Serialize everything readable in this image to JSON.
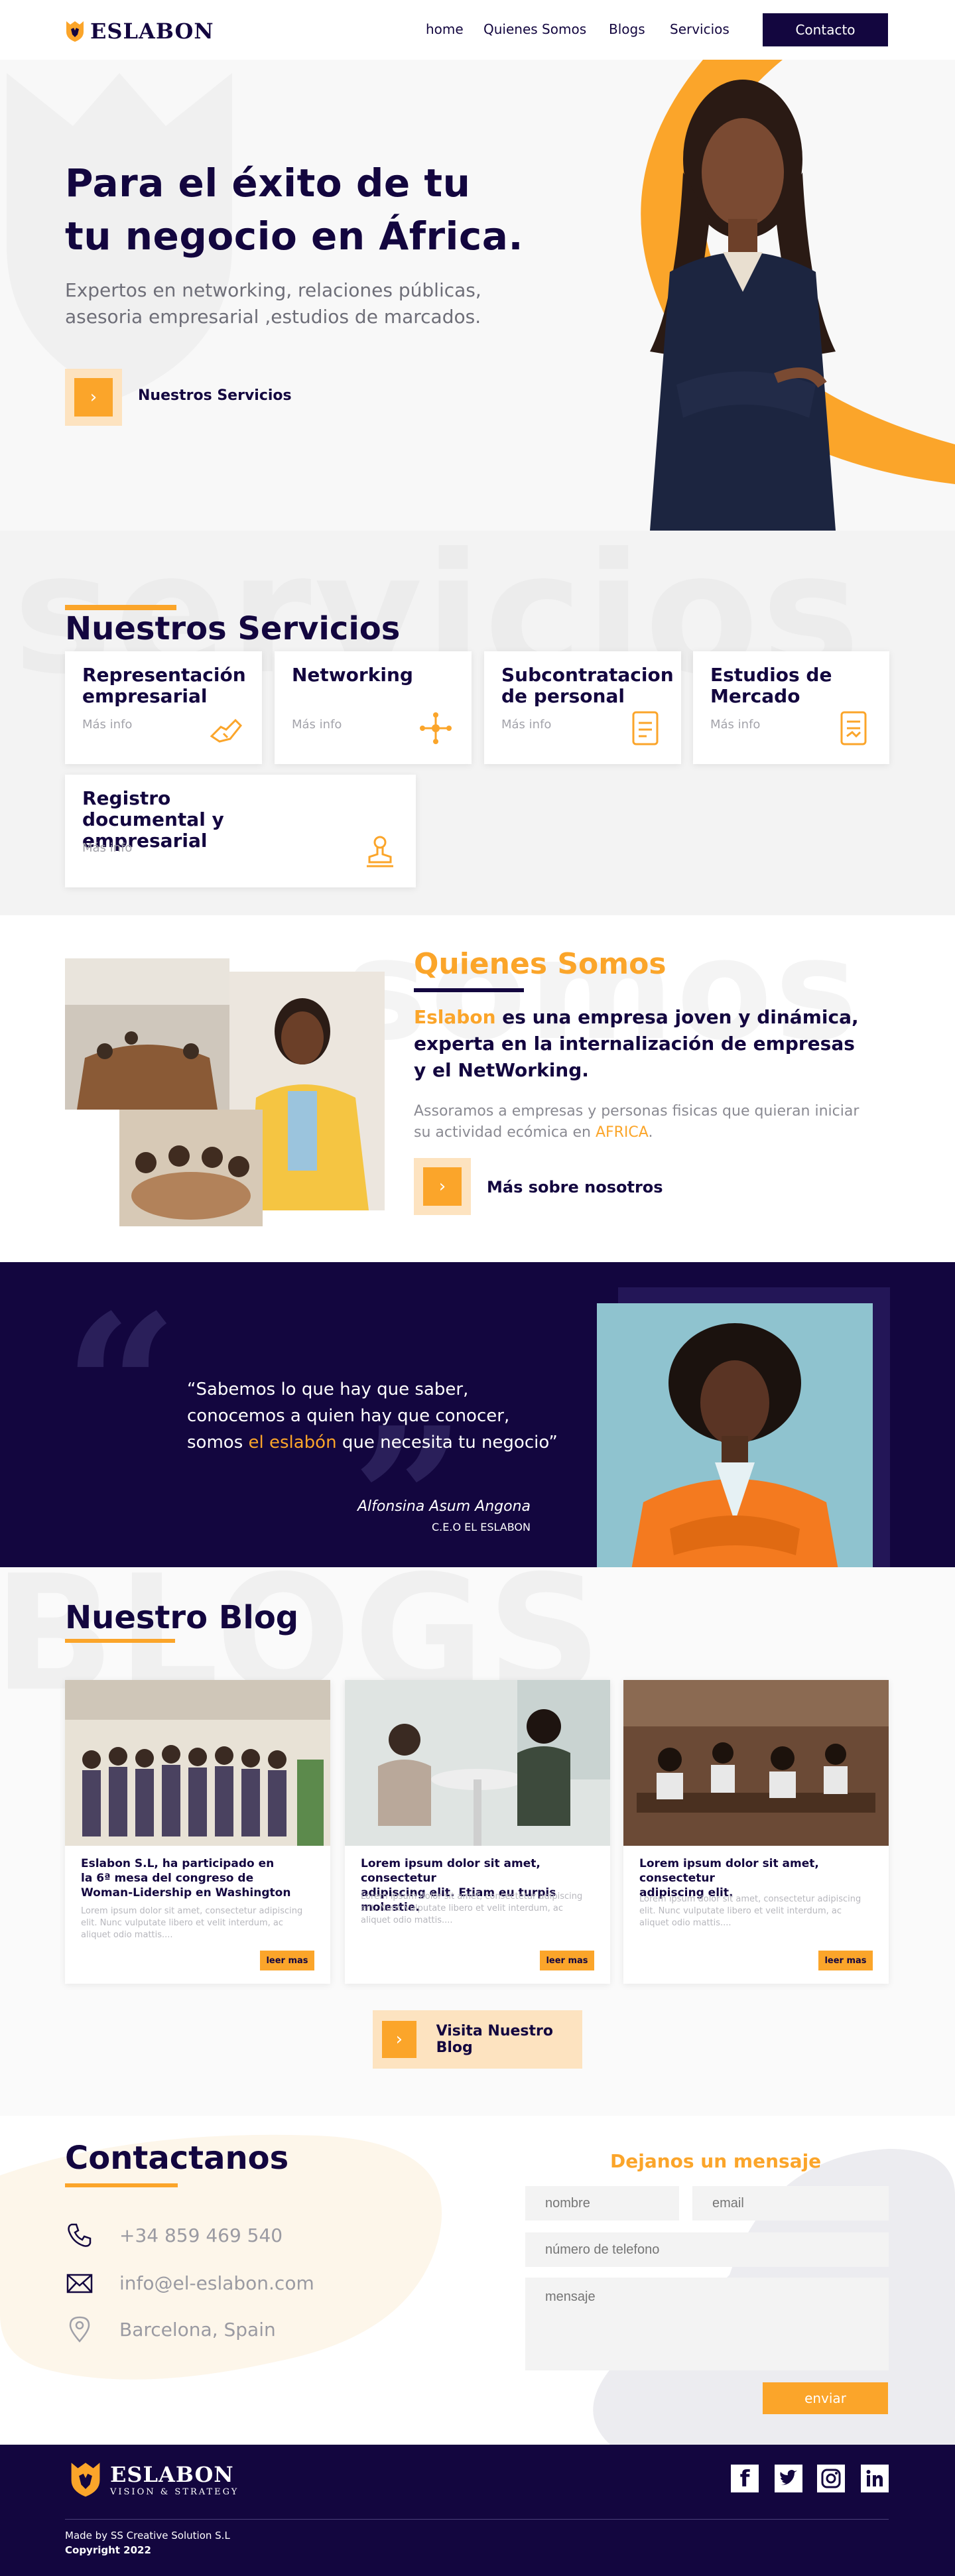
{
  "header": {
    "logo_text": "ESLABON",
    "nav": [
      "home",
      "Quienes Somos",
      "Blogs",
      "Servicios"
    ],
    "contact_button": "Contacto"
  },
  "hero": {
    "title_line1": "Para el éxito de  tu",
    "title_line2": "tu negocio en África.",
    "subtitle": "Expertos en networking, relaciones públicas, asesoria empresarial ,estudios de marcados.",
    "cta_label": "Nuestros Servicios"
  },
  "services": {
    "watermark": "servicios",
    "title": "Nuestros Servicios",
    "cards": [
      {
        "title": "Representación empresarial",
        "more": "Más info",
        "icon": "handshake-icon"
      },
      {
        "title": "Networking",
        "more": "Más info",
        "icon": "network-icon"
      },
      {
        "title": "Subcontratacion de personal",
        "more": "Más info",
        "icon": "document-icon"
      },
      {
        "title": "Estudios de Mercado",
        "more": "Más info",
        "icon": "report-icon"
      },
      {
        "title": "Registro documental y empresarial",
        "more": "Más info",
        "icon": "stamp-icon"
      }
    ]
  },
  "about": {
    "watermark": "somos",
    "title": "Quienes Somos",
    "headline_brand": "Eslabon",
    "headline_rest_1": " es una empresa joven y dinámica,",
    "headline_line2": "experta en la internalización de empresas",
    "headline_line3": "y el NetWorking.",
    "body": "Assoramos a empresas y personas fisicas  que  quieran iniciar su  actividad ecómica en ",
    "body_highlight": "AFRICA",
    "body_end": ".",
    "cta_label": "Más sobre nosotros"
  },
  "quote": {
    "line1": "“Sabemos lo que hay que saber,",
    "line2": "conocemos a quien hay que conocer,",
    "line3_start": "somos ",
    "line3_highlight": "el eslabón",
    "line3_end": " que necesita tu negocio”",
    "author": "Alfonsina Asum Angona",
    "role": "C.E.O EL ESLABON"
  },
  "blog": {
    "watermark": "BLOGS",
    "title": "Nuestro Blog",
    "posts": [
      {
        "title_1": "Eslabon S.L, ha participado en",
        "title_2": "la  6ª mesa del congreso  de",
        "title_3": "Woman-Lidership en Washington",
        "excerpt": "Lorem ipsum dolor sit amet, consectetur adipiscing elit. Nunc vulputate libero et velit interdum, ac aliquet odio mattis....",
        "button": "leer mas"
      },
      {
        "title_1": "Lorem ipsum dolor sit amet, consectetur",
        "title_2": "adipiscing elit. Etiam eu turpis molestie.",
        "title_3": "",
        "excerpt": "Lorem ipsum dolor sit amet, consectetur adipiscing elit. Nunc vulputate libero et velit interdum, ac aliquet odio mattis....",
        "button": "leer mas"
      },
      {
        "title_1": "Lorem ipsum dolor sit amet, consectetur",
        "title_2": "adipiscing elit.",
        "title_3": "",
        "excerpt": "Lorem ipsum dolor sit amet, consectetur adipiscing elit. Nunc vulputate libero et velit interdum, ac aliquet odio mattis....",
        "button": "leer mas"
      }
    ],
    "cta_label": "Visita Nuestro Blog"
  },
  "contact": {
    "title": "Contactanos",
    "phone": "+34 859 469 540",
    "email": "info@el-eslabon.com",
    "location": "Barcelona, Spain",
    "form_title": "Dejanos un mensaje",
    "placeholders": {
      "name": "nombre",
      "email": "email",
      "phone": "número de telefono",
      "message": "mensaje"
    },
    "submit": "enviar"
  },
  "footer": {
    "logo_text": "ESLABON",
    "tagline": "VISION & STRATEGY",
    "made_by": "Made by SS Creative Solution S.L",
    "copyright": "Copyright 2022"
  },
  "colors": {
    "navy": "#13063f",
    "orange": "#fba52a",
    "light_orange": "#fde3c0"
  }
}
